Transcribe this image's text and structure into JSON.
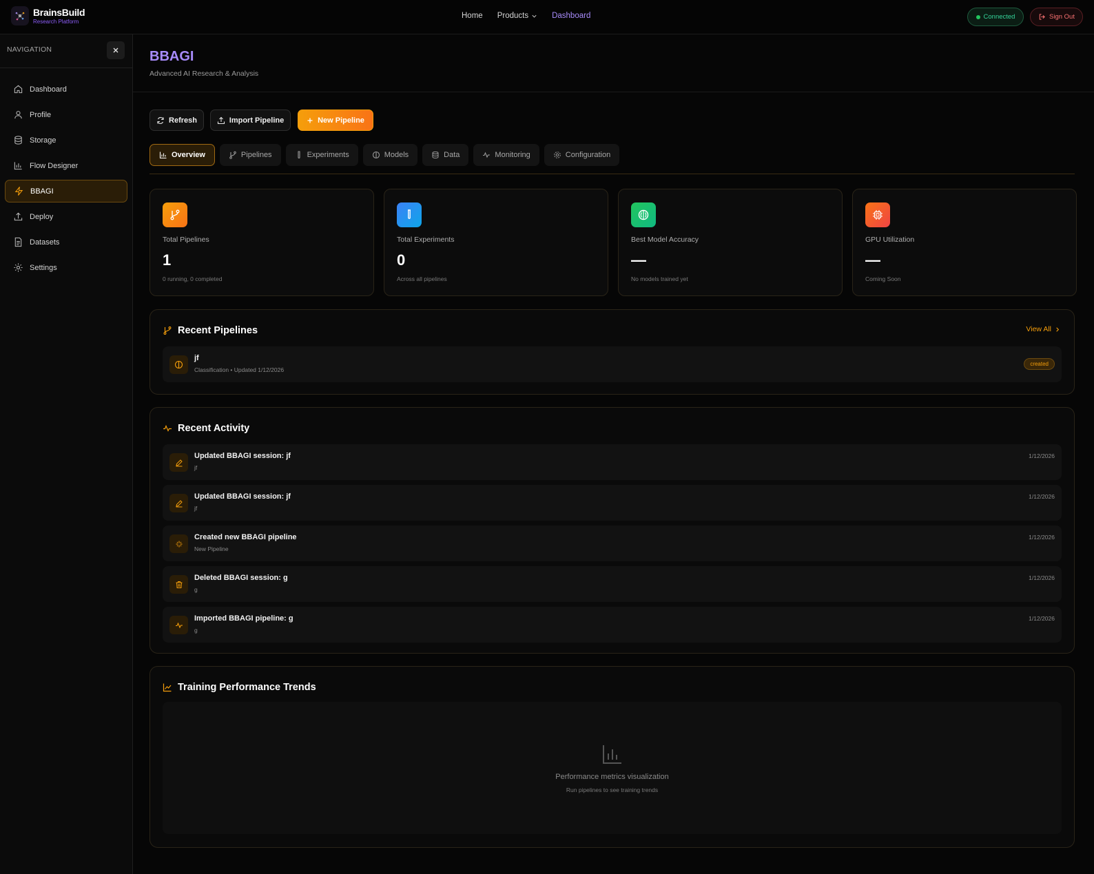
{
  "brand": {
    "name": "BrainsBuild",
    "subtitle": "Research Platform"
  },
  "topnav": {
    "home": "Home",
    "products": "Products",
    "dashboard": "Dashboard"
  },
  "status": {
    "connected": "Connected",
    "signout": "Sign Out"
  },
  "sidebar": {
    "title": "NAVIGATION",
    "items": [
      {
        "label": "Dashboard",
        "icon": "home-icon"
      },
      {
        "label": "Profile",
        "icon": "user-icon"
      },
      {
        "label": "Storage",
        "icon": "database-icon"
      },
      {
        "label": "Flow Designer",
        "icon": "bar-chart-icon"
      },
      {
        "label": "BBAGI",
        "icon": "bolt-icon",
        "active": true
      },
      {
        "label": "Deploy",
        "icon": "upload-icon"
      },
      {
        "label": "Datasets",
        "icon": "file-icon"
      },
      {
        "label": "Settings",
        "icon": "gear-icon"
      }
    ]
  },
  "page": {
    "title": "BBAGI",
    "subtitle": "Advanced AI Research & Analysis"
  },
  "actions": {
    "refresh": "Refresh",
    "import": "Import Pipeline",
    "new": "New Pipeline"
  },
  "tabs": [
    {
      "label": "Overview",
      "active": true
    },
    {
      "label": "Pipelines"
    },
    {
      "label": "Experiments"
    },
    {
      "label": "Models"
    },
    {
      "label": "Data"
    },
    {
      "label": "Monitoring"
    },
    {
      "label": "Configuration"
    }
  ],
  "stats": [
    {
      "label": "Total Pipelines",
      "value": "1",
      "note": "0 running, 0 completed",
      "color": "#f59e0b"
    },
    {
      "label": "Total Experiments",
      "value": "0",
      "note": "Across all pipelines",
      "color": "#3b82f6"
    },
    {
      "label": "Best Model Accuracy",
      "value": "—",
      "note": "No models trained yet",
      "color": "#22c55e"
    },
    {
      "label": "GPU Utilization",
      "value": "—",
      "note": "Coming Soon",
      "color": "#f97316"
    }
  ],
  "recent_pipelines": {
    "title": "Recent Pipelines",
    "view_all": "View All",
    "items": [
      {
        "name": "jf",
        "meta": "Classification • Updated 1/12/2026",
        "status": "created"
      }
    ]
  },
  "recent_activity": {
    "title": "Recent Activity",
    "items": [
      {
        "title": "Updated BBAGI session: jf",
        "sub": "jf",
        "date": "1/12/2026",
        "icon": "edit-icon"
      },
      {
        "title": "Updated BBAGI session: jf",
        "sub": "jf",
        "date": "1/12/2026",
        "icon": "edit-icon"
      },
      {
        "title": "Created new BBAGI pipeline",
        "sub": "New Pipeline",
        "date": "1/12/2026",
        "icon": "sparkle-icon"
      },
      {
        "title": "Deleted BBAGI session: g",
        "sub": "g",
        "date": "1/12/2026",
        "icon": "trash-icon"
      },
      {
        "title": "Imported BBAGI pipeline: g",
        "sub": "g",
        "date": "1/12/2026",
        "icon": "activity-icon"
      }
    ]
  },
  "training": {
    "title": "Training Performance Trends",
    "empty_title": "Performance metrics visualization",
    "empty_sub": "Run pipelines to see training trends"
  },
  "colors": {
    "accent": "#f59e0b",
    "brand_purple": "#a78bfa",
    "success": "#22c55e",
    "danger": "#f87171"
  }
}
